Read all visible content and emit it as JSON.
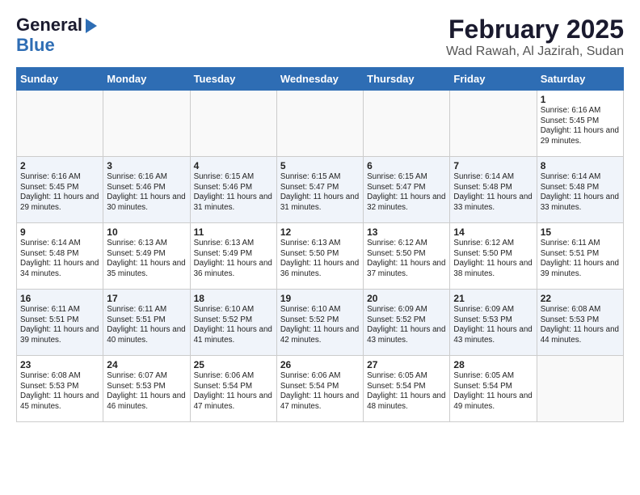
{
  "logo": {
    "line1": "General",
    "line2": "Blue"
  },
  "title": "February 2025",
  "subtitle": "Wad Rawah, Al Jazirah, Sudan",
  "days_of_week": [
    "Sunday",
    "Monday",
    "Tuesday",
    "Wednesday",
    "Thursday",
    "Friday",
    "Saturday"
  ],
  "weeks": [
    [
      {
        "day": "",
        "content": ""
      },
      {
        "day": "",
        "content": ""
      },
      {
        "day": "",
        "content": ""
      },
      {
        "day": "",
        "content": ""
      },
      {
        "day": "",
        "content": ""
      },
      {
        "day": "",
        "content": ""
      },
      {
        "day": "1",
        "content": "Sunrise: 6:16 AM\nSunset: 5:45 PM\nDaylight: 11 hours and 29 minutes."
      }
    ],
    [
      {
        "day": "2",
        "content": "Sunrise: 6:16 AM\nSunset: 5:45 PM\nDaylight: 11 hours and 29 minutes."
      },
      {
        "day": "3",
        "content": "Sunrise: 6:16 AM\nSunset: 5:46 PM\nDaylight: 11 hours and 30 minutes."
      },
      {
        "day": "4",
        "content": "Sunrise: 6:15 AM\nSunset: 5:46 PM\nDaylight: 11 hours and 31 minutes."
      },
      {
        "day": "5",
        "content": "Sunrise: 6:15 AM\nSunset: 5:47 PM\nDaylight: 11 hours and 31 minutes."
      },
      {
        "day": "6",
        "content": "Sunrise: 6:15 AM\nSunset: 5:47 PM\nDaylight: 11 hours and 32 minutes."
      },
      {
        "day": "7",
        "content": "Sunrise: 6:14 AM\nSunset: 5:48 PM\nDaylight: 11 hours and 33 minutes."
      },
      {
        "day": "8",
        "content": "Sunrise: 6:14 AM\nSunset: 5:48 PM\nDaylight: 11 hours and 33 minutes."
      }
    ],
    [
      {
        "day": "9",
        "content": "Sunrise: 6:14 AM\nSunset: 5:48 PM\nDaylight: 11 hours and 34 minutes."
      },
      {
        "day": "10",
        "content": "Sunrise: 6:13 AM\nSunset: 5:49 PM\nDaylight: 11 hours and 35 minutes."
      },
      {
        "day": "11",
        "content": "Sunrise: 6:13 AM\nSunset: 5:49 PM\nDaylight: 11 hours and 36 minutes."
      },
      {
        "day": "12",
        "content": "Sunrise: 6:13 AM\nSunset: 5:50 PM\nDaylight: 11 hours and 36 minutes."
      },
      {
        "day": "13",
        "content": "Sunrise: 6:12 AM\nSunset: 5:50 PM\nDaylight: 11 hours and 37 minutes."
      },
      {
        "day": "14",
        "content": "Sunrise: 6:12 AM\nSunset: 5:50 PM\nDaylight: 11 hours and 38 minutes."
      },
      {
        "day": "15",
        "content": "Sunrise: 6:11 AM\nSunset: 5:51 PM\nDaylight: 11 hours and 39 minutes."
      }
    ],
    [
      {
        "day": "16",
        "content": "Sunrise: 6:11 AM\nSunset: 5:51 PM\nDaylight: 11 hours and 39 minutes."
      },
      {
        "day": "17",
        "content": "Sunrise: 6:11 AM\nSunset: 5:51 PM\nDaylight: 11 hours and 40 minutes."
      },
      {
        "day": "18",
        "content": "Sunrise: 6:10 AM\nSunset: 5:52 PM\nDaylight: 11 hours and 41 minutes."
      },
      {
        "day": "19",
        "content": "Sunrise: 6:10 AM\nSunset: 5:52 PM\nDaylight: 11 hours and 42 minutes."
      },
      {
        "day": "20",
        "content": "Sunrise: 6:09 AM\nSunset: 5:52 PM\nDaylight: 11 hours and 43 minutes."
      },
      {
        "day": "21",
        "content": "Sunrise: 6:09 AM\nSunset: 5:53 PM\nDaylight: 11 hours and 43 minutes."
      },
      {
        "day": "22",
        "content": "Sunrise: 6:08 AM\nSunset: 5:53 PM\nDaylight: 11 hours and 44 minutes."
      }
    ],
    [
      {
        "day": "23",
        "content": "Sunrise: 6:08 AM\nSunset: 5:53 PM\nDaylight: 11 hours and 45 minutes."
      },
      {
        "day": "24",
        "content": "Sunrise: 6:07 AM\nSunset: 5:53 PM\nDaylight: 11 hours and 46 minutes."
      },
      {
        "day": "25",
        "content": "Sunrise: 6:06 AM\nSunset: 5:54 PM\nDaylight: 11 hours and 47 minutes."
      },
      {
        "day": "26",
        "content": "Sunrise: 6:06 AM\nSunset: 5:54 PM\nDaylight: 11 hours and 47 minutes."
      },
      {
        "day": "27",
        "content": "Sunrise: 6:05 AM\nSunset: 5:54 PM\nDaylight: 11 hours and 48 minutes."
      },
      {
        "day": "28",
        "content": "Sunrise: 6:05 AM\nSunset: 5:54 PM\nDaylight: 11 hours and 49 minutes."
      },
      {
        "day": "",
        "content": ""
      }
    ]
  ]
}
